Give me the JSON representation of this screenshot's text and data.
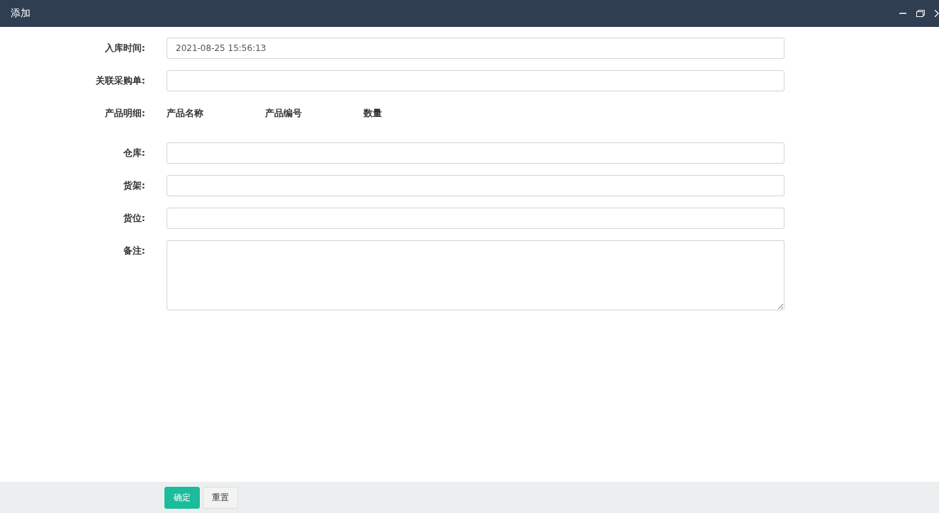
{
  "window": {
    "title": "添加"
  },
  "fields": [
    {
      "kind": "input",
      "label": "入库时间:",
      "value": "2021-08-25 15:56:13"
    },
    {
      "kind": "input",
      "label": "关联采购单:"
    },
    {
      "kind": "columns",
      "label": "产品明细:",
      "columns": [
        "产品名称",
        "产品编号",
        "数量"
      ]
    },
    {
      "kind": "input",
      "label": "仓库:"
    },
    {
      "kind": "input",
      "label": "货架:"
    },
    {
      "kind": "input",
      "label": "货位:"
    },
    {
      "kind": "textarea",
      "label": "备注:"
    }
  ],
  "buttons": [
    {
      "label": "确定",
      "kind": "primary"
    },
    {
      "label": "重置",
      "kind": "default"
    }
  ]
}
